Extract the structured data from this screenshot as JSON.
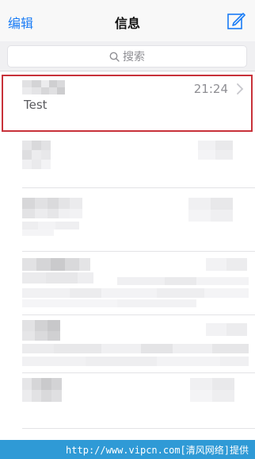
{
  "nav": {
    "edit_label": "编辑",
    "title": "信息",
    "compose_icon": "compose-icon"
  },
  "search": {
    "placeholder": "搜索",
    "icon": "search-icon"
  },
  "conversations": [
    {
      "name": "",
      "time": "21:24",
      "preview": "Test",
      "selected": true
    },
    {
      "name": "",
      "time": "",
      "preview": "",
      "selected": false
    },
    {
      "name": "",
      "time": "",
      "preview": "",
      "selected": false
    },
    {
      "name": "",
      "time": "",
      "preview": "",
      "selected": false
    },
    {
      "name": "",
      "time": "",
      "preview": "",
      "selected": false
    },
    {
      "name": "",
      "time": "",
      "preview": "",
      "selected": false
    }
  ],
  "footer": {
    "text": "http://www.vipcn.com[清风网络]提供"
  },
  "colors": {
    "accent": "#1a7cf5",
    "highlight": "#c8323a",
    "footer_bg": "#2f9ad6"
  }
}
